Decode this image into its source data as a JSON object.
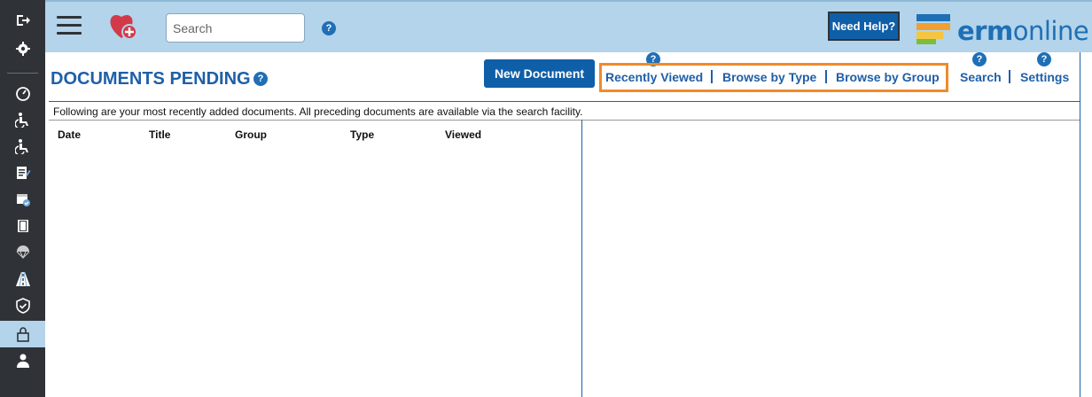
{
  "sidebar": {
    "items": [
      {
        "icon": "logout-icon"
      },
      {
        "icon": "gear-icon"
      },
      {
        "icon": "dashboard-gauge-icon"
      },
      {
        "icon": "wheelchair-icon"
      },
      {
        "icon": "wheelchair-icon"
      },
      {
        "icon": "document-edit-icon"
      },
      {
        "icon": "calendar-check-icon"
      },
      {
        "icon": "book-icon"
      },
      {
        "icon": "parachute-icon"
      },
      {
        "icon": "road-icon"
      },
      {
        "icon": "shield-check-icon"
      },
      {
        "icon": "lock-icon",
        "active": true
      },
      {
        "icon": "user-icon"
      }
    ]
  },
  "header": {
    "search_placeholder": "Search",
    "need_help_label": "Need Help?",
    "brand_text_bold": "erm",
    "brand_text_light": "online"
  },
  "page": {
    "title": "DOCUMENTS PENDING",
    "new_document_label": "New Document",
    "info_text": "Following are your most recently added documents. All preceding documents are available via the search facility."
  },
  "nav": {
    "recently_viewed": "Recently Viewed",
    "browse_by_type": "Browse by Type",
    "browse_by_group": "Browse by Group",
    "search": "Search",
    "settings": "Settings"
  },
  "table": {
    "columns": [
      "Date",
      "Title",
      "Group",
      "Type",
      "Viewed"
    ]
  },
  "help_glyph": "?",
  "colors": {
    "header_bg": "#b3d4ea",
    "sidebar_bg": "#2f3338",
    "accent_blue": "#1f5fa8",
    "highlight_orange": "#f08a2a"
  }
}
